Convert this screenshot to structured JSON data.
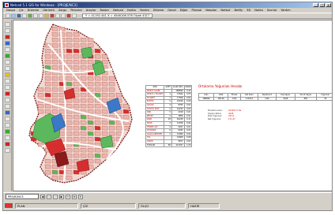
{
  "window": {
    "title": "Netcad 5.1 GIS for Windows - [PROJE/NC3]",
    "buttons": [
      "_",
      "□",
      "x"
    ]
  },
  "menu": [
    "Dosya",
    "Çiz",
    "Düzenle",
    "Görüntü",
    "Sorgu",
    "Pencere",
    "Araçlar",
    "Raster",
    "Netcad",
    "Harita",
    "Yardım",
    "Ekleme",
    "Genel",
    "Diğer",
    "Plansal",
    "Netplan",
    "Netbuf",
    "Netfiy",
    "3D",
    "Nokta",
    "Sınırlar",
    "Yardım"
  ],
  "coords": "Y = 41192.441  X = 4546106.578  Ölçek 4317",
  "layer_name": "PROJE/NC3",
  "status": [
    "PLAN",
    "ÇİZ",
    "ÖLÇÜ",
    "HAZIR"
  ],
  "land_table": {
    "headers": [
      "KOD",
      "ADET",
      "ALAN (M2)",
      "ORAN"
    ],
    "rows": [
      [
        "KONUT ALANI",
        "",
        "188690",
        "0.45"
      ],
      [
        "KONUT+TİCARET",
        "4",
        "12842",
        "0.03"
      ],
      [
        "TİCARET",
        "7",
        "17508",
        "0.04"
      ],
      [
        "EĞİTİM",
        "5",
        "24018",
        "0.06"
      ],
      [
        "SAĞLIK",
        "3",
        "8765",
        "0.02"
      ],
      [
        "SOSYAL KÜLT.",
        "4",
        "10232",
        "0.02"
      ],
      [
        "DİNİ",
        "5",
        "4318",
        "0.01"
      ],
      [
        "RESMİ",
        "2",
        "3856",
        "0.01"
      ],
      [
        "PARK",
        "18",
        "46228",
        "0.11"
      ],
      [
        "SPOR",
        "3",
        "14766",
        "0.04"
      ],
      [
        "TEKNİK ALT.",
        "9",
        "5207",
        "0.01"
      ],
      [
        "OTOPARK",
        "6",
        "6935",
        "0.02"
      ],
      [
        "AĞAÇLANDIRMA",
        "2",
        "15080",
        "0.04"
      ],
      [
        "YOL",
        "",
        "34008",
        "0.08"
      ],
      [
        "DİĞER",
        "",
        "9817",
        "0.02"
      ]
    ],
    "total": [
      "TOPLAM",
      "68",
      "413027",
      "1.00"
    ]
  },
  "density": {
    "title": "Ortalama Yoğunluk Hesabı",
    "headers": [
      "Alan",
      "Adet",
      "Emsal",
      "Kat Alanı",
      "Kişi/Konut",
      "Kişi Sayısı",
      "Konut Sayısı",
      "Yoğunluk"
    ],
    "rows": [
      [
        "188690",
        "165.00",
        "0.60",
        "113214",
        "3.80",
        "3228",
        "850",
        "78"
      ]
    ],
    "notes": [
      [
        "Planlama Alanı",
        "413027.0  Ha"
      ],
      [
        "Toplam Nüfus",
        "3228"
      ],
      [
        "Brüt Yoğunluk",
        "78.15"
      ],
      [
        "Net Yoğunluk",
        "171.07"
      ]
    ]
  },
  "colors": {
    "residential": "#e8b7b0",
    "residential_outline": "#b24a3a",
    "commercial": "#d62e2e",
    "park": "#5cb85c",
    "education": "#3b79c8",
    "road": "#ffffff",
    "boundary": "#7a1a1a"
  }
}
